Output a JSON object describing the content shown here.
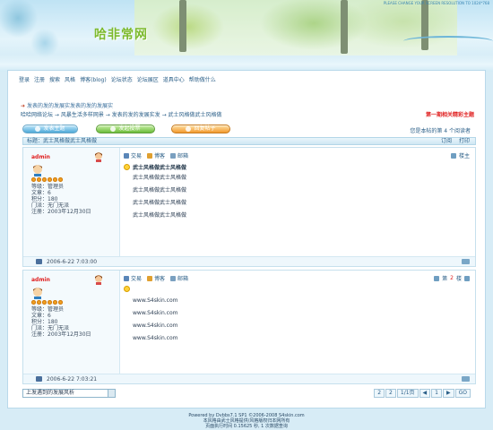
{
  "header": {
    "logo": "哈非常网",
    "note": "PLEASE CHANGE YOUR SCREEN RESOLUTION TO 1024*768"
  },
  "topnav": [
    "登录",
    "注册",
    "搜索",
    "风格",
    "博客(blog)",
    "论坛状态",
    "论坛展区",
    "道具中心",
    "帮助做什么"
  ],
  "announcement": "发表的发的发展实发表的发的发展实",
  "breadcrumb": {
    "path": "哈哈网络论坛 → 风暴生活多样网景 → 发表的发的发展实发 → 武士风格做武士风格做",
    "hot_label": "第一期相关精彩主题"
  },
  "actions": {
    "new_topic": "发表主题",
    "new_poll": "发起投票",
    "reply": "回复帖子"
  },
  "view_count": "您是本帖的第 4 个阅读者",
  "thread": {
    "title": "标题：武士风格做武士风格做",
    "print_label": "打印",
    "subscribe_label": "订阅"
  },
  "tools": {
    "exchange": "交易",
    "blog": "博客",
    "mail": "邮箱"
  },
  "posts": [
    {
      "author": "admin",
      "role": "等级：管理员",
      "articles": "文章：6",
      "points": "积分：180",
      "sect": "门派：无门无派",
      "registered": "注册：2003年12月30日",
      "floor_label": "楼主",
      "title": "武士风格做武士风格做",
      "lines": [
        "武士风格做武士风格做",
        "武士风格做武士风格做",
        "武士风格做武士风格做",
        "武士风格做武士风格做"
      ],
      "date": "2006-6-22 7:03:00"
    },
    {
      "author": "admin",
      "role": "等级：管理员",
      "articles": "文章：6",
      "points": "积分：180",
      "sect": "门派：无门无派",
      "registered": "注册：2003年12月30日",
      "floor_prefix": "第",
      "floor_num": "2",
      "floor_suffix": "楼",
      "lines": [
        "www.S4skin.com",
        "www.S4skin.com",
        "www.S4skin.com",
        "www.S4skin.com"
      ],
      "date": "2006-6-22 7:03:21"
    }
  ],
  "jump_select": "上发遇到的发展风析",
  "pager": [
    "2",
    "2",
    "1/1页",
    "◀",
    "1",
    "▶",
    "GO"
  ],
  "footer": {
    "line1": "Powered by Dvbbs7.1 SP1 ©2006-2008 S4skin.com",
    "line2": "本风格由武士风格提供/风格版权归本网所有",
    "line3": "页面执行时间 0.15625 秒, 1 次数据查询"
  }
}
